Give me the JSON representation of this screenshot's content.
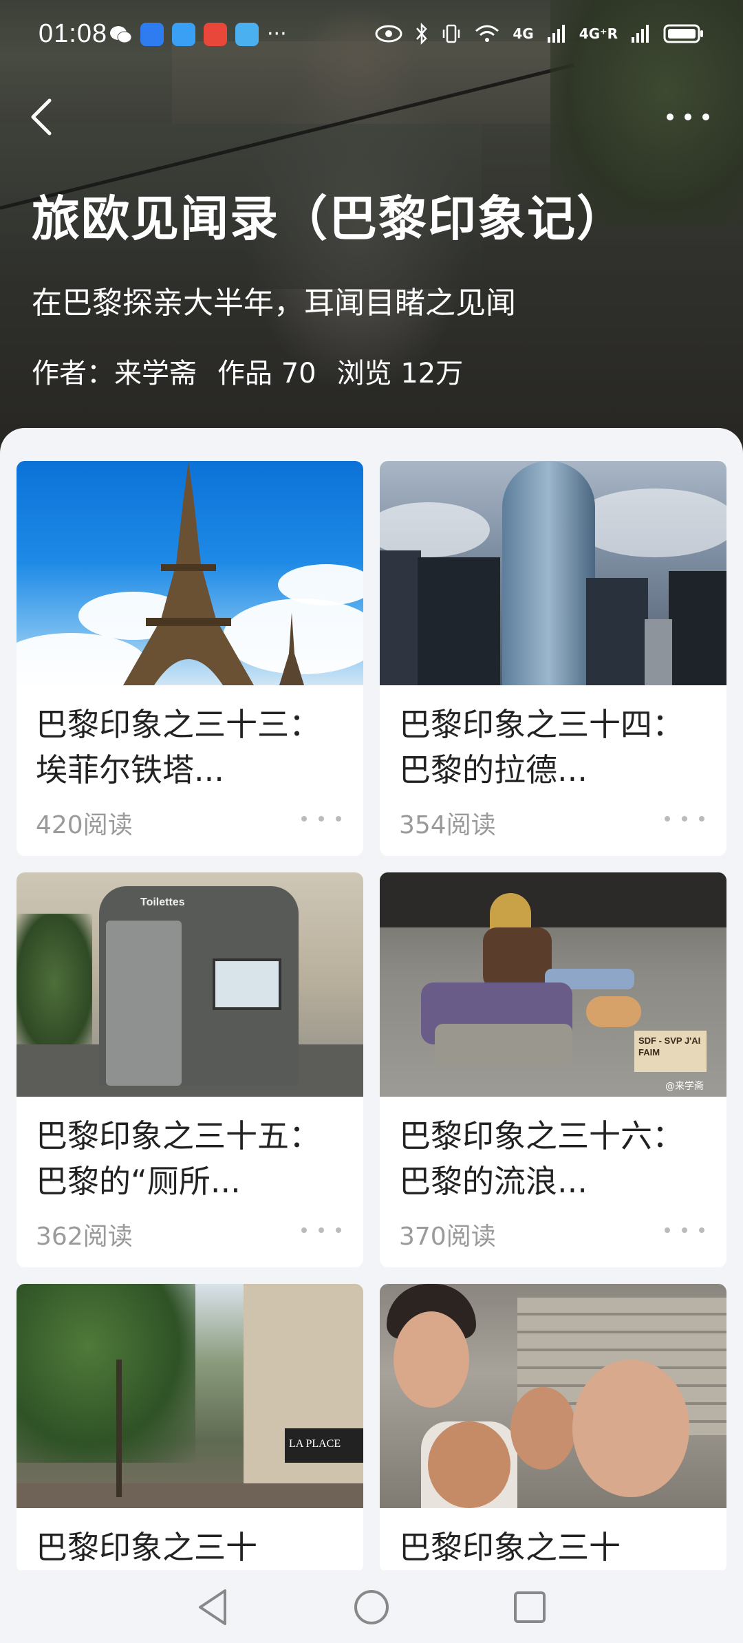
{
  "status": {
    "time": "01:08",
    "sig1": "4G",
    "sig2": "4G⁺R"
  },
  "header": {
    "title": "旅欧见闻录（巴黎印象记）",
    "subtitle": "在巴黎探亲大半年，耳闻目睹之见闻",
    "author": "作者：来学斋",
    "works": "作品 70",
    "views": "浏览 12万"
  },
  "cards": [
    {
      "title": "巴黎印象之三十三：埃菲尔铁塔...",
      "reads": "420阅读"
    },
    {
      "title": "巴黎印象之三十四：巴黎的拉德...",
      "reads": "354阅读"
    },
    {
      "title": "巴黎印象之三十五：巴黎的“厕所...",
      "reads": "362阅读"
    },
    {
      "title": "巴黎印象之三十六：巴黎的流浪...",
      "reads": "370阅读"
    },
    {
      "title": "巴黎印象之三十",
      "reads": ""
    },
    {
      "title": "巴黎印象之三十",
      "reads": ""
    }
  ],
  "images": {
    "toilet_sign": "Toilettes",
    "homeless_sign": "SDF - SVP J'AI FAIM",
    "watermark": "@来学斋",
    "cafe_sign": "LA PLACE"
  },
  "colors": {
    "sheet_bg": "#f3f4f7",
    "title_text": "#222222",
    "meta_text": "#9a9a9a"
  }
}
